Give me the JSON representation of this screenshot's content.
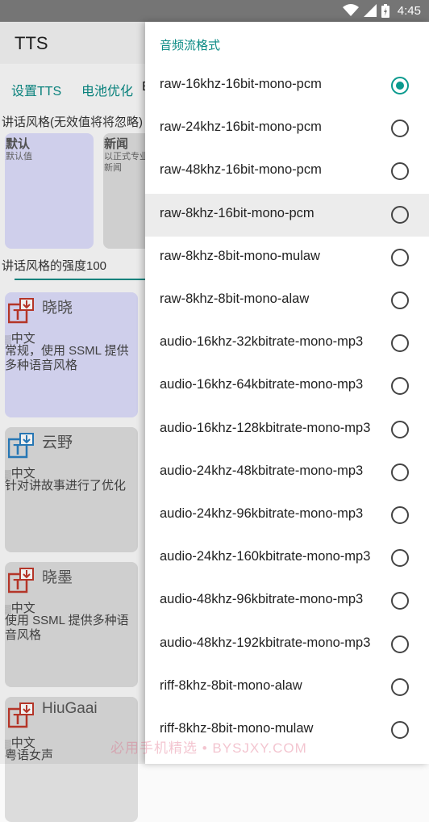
{
  "status": {
    "time": "4:45"
  },
  "app": {
    "title": "TTS"
  },
  "tabs": [
    {
      "label": "设置TTS"
    },
    {
      "label": "电池优化"
    },
    {
      "label": "E"
    }
  ],
  "style_section": {
    "label": "讲话风格(无效值将将忽略)",
    "cards": [
      {
        "name": "默认",
        "desc": "默认值"
      },
      {
        "name": "新闻",
        "desc": "以正式专业\n新闻"
      }
    ]
  },
  "intensity": {
    "label": "讲话风格的强度100"
  },
  "voices": [
    {
      "name": "晓晓",
      "lang": "中文",
      "desc": "常规，使用 SSML 提供多种语音风格",
      "selected": true
    },
    {
      "name": "云野",
      "lang": "中文",
      "desc": "针对讲故事进行了优化",
      "selected": false
    },
    {
      "name": "晓墨",
      "lang": "中文",
      "desc": "使用 SSML 提供多种语音风格",
      "selected": false
    },
    {
      "name": "HiuGaai",
      "lang": "中文",
      "desc": "粤语女声",
      "selected": false
    }
  ],
  "dialog": {
    "title": "音频流格式",
    "options": [
      {
        "label": "raw-16khz-16bit-mono-pcm",
        "checked": true
      },
      {
        "label": "raw-24khz-16bit-mono-pcm",
        "checked": false
      },
      {
        "label": "raw-48khz-16bit-mono-pcm",
        "checked": false
      },
      {
        "label": "raw-8khz-16bit-mono-pcm",
        "checked": false
      },
      {
        "label": "raw-8khz-8bit-mono-mulaw",
        "checked": false
      },
      {
        "label": "raw-8khz-8bit-mono-alaw",
        "checked": false
      },
      {
        "label": "audio-16khz-32kbitrate-mono-mp3",
        "checked": false
      },
      {
        "label": "audio-16khz-64kbitrate-mono-mp3",
        "checked": false
      },
      {
        "label": "audio-16khz-128kbitrate-mono-mp3",
        "checked": false
      },
      {
        "label": "audio-24khz-48kbitrate-mono-mp3",
        "checked": false
      },
      {
        "label": "audio-24khz-96kbitrate-mono-mp3",
        "checked": false
      },
      {
        "label": "audio-24khz-160kbitrate-mono-mp3",
        "checked": false
      },
      {
        "label": "audio-48khz-96kbitrate-mono-mp3",
        "checked": false
      },
      {
        "label": "audio-48khz-192kbitrate-mono-mp3",
        "checked": false
      },
      {
        "label": "riff-8khz-8bit-mono-alaw",
        "checked": false
      },
      {
        "label": "riff-8khz-8bit-mono-mulaw",
        "checked": false
      }
    ]
  },
  "watermark": "必用手机精选 • BYSJXY.COM",
  "colors": {
    "accent": "#0a8a84",
    "radio_checked": "#0a9a8e",
    "selected_card": "#dcdcfa",
    "card": "#dcdcdc",
    "icon_red": "#c0392b",
    "icon_blue": "#2a7fc0"
  }
}
